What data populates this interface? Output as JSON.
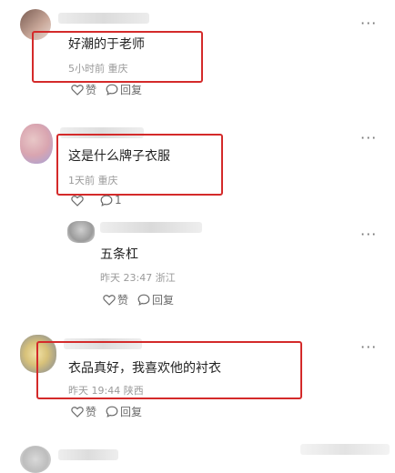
{
  "comments": [
    {
      "text": "好潮的于老师",
      "meta": "5小时前 重庆",
      "like_label": "赞",
      "reply_label": "回复"
    },
    {
      "text": "这是什么牌子衣服",
      "meta": "1天前 重庆",
      "like_label": "",
      "reply_label": "1"
    },
    {
      "text": "五条杠",
      "meta": "昨天 23:47 浙江",
      "like_label": "赞",
      "reply_label": "回复"
    },
    {
      "text": "衣品真好，我喜欢他的衬衣",
      "meta": "昨天 19:44 陕西",
      "like_label": "赞",
      "reply_label": "回复"
    }
  ],
  "icons": {
    "more": "more-dots-icon",
    "like": "heart-icon",
    "reply": "comment-bubble-icon"
  },
  "colors": {
    "highlight_box": "#d42a2a",
    "meta_text": "#9a9a9a"
  }
}
